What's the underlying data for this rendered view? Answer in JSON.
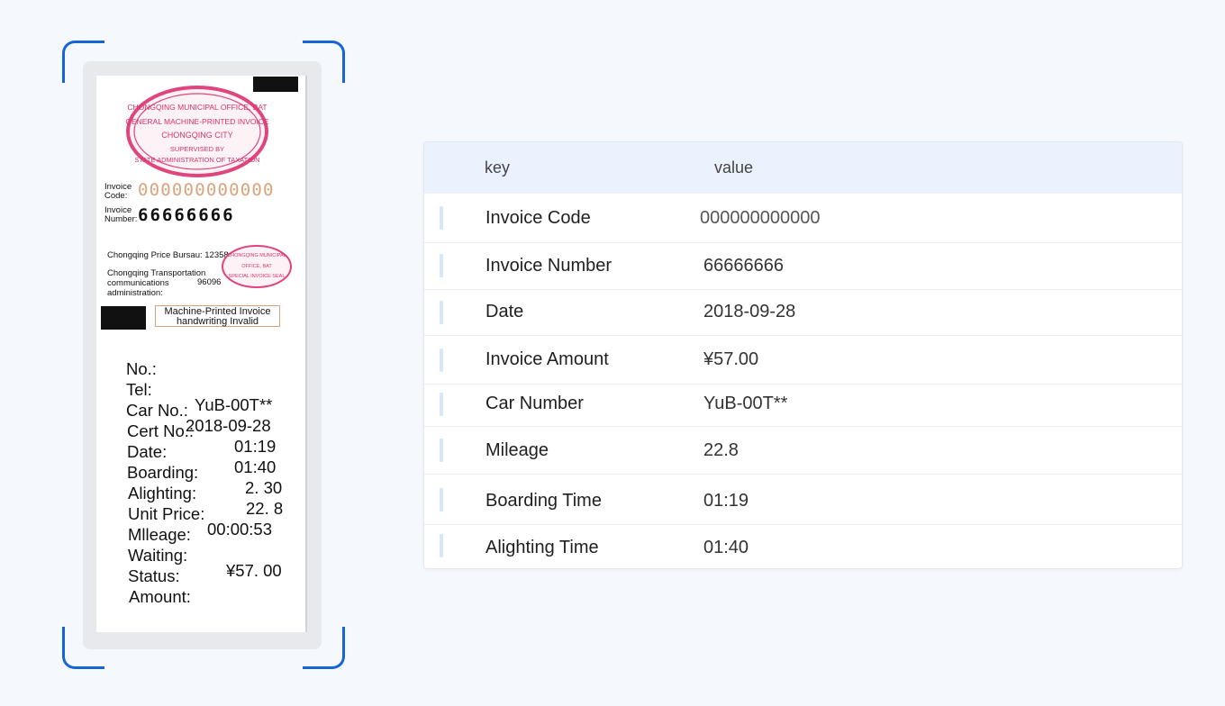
{
  "receipt": {
    "seal_main": {
      "line1": "CHONGQING MUNICIPAL OFFICE, BAT",
      "line2": "GENERAL MACHINE-PRINTED INVOICE",
      "line3": "CHONGQING CITY",
      "line4": "SUPERVISED BY",
      "line5": "STATE ADMINISTRATION OF TAXATION"
    },
    "invoice_code_label": "Invoice\nCode:",
    "invoice_code_digits": "000000000000",
    "invoice_number_label": "Invoice\nNumber:",
    "invoice_number_digits": "66666666",
    "price_bureau": "Chongqing Price Bursau: 12358",
    "transport_line1": "Chongqing Transportation",
    "transport_line2": "communications",
    "transport_line3": "administration:",
    "transport_number": "96096",
    "seal_small": {
      "line1": "CHONGQING MUNICIPAL",
      "line2": "OFFICE, BAT",
      "line3": "SPECIAL INVOICE SEAL"
    },
    "notice_line1": "Machine-Printed Invoice",
    "notice_line2": "handwriting Invalid",
    "labels": [
      "No.:",
      "Tel:",
      "Car No.:",
      "Cert No.:",
      "Date:",
      "Boarding:",
      "Alighting:",
      "Unit Price:",
      "Mlleage:",
      "Waiting:",
      "Status:",
      "Amount:"
    ],
    "values": {
      "car_no": "YuB-00T**",
      "date": "2018-09-28",
      "boarding": "01:19",
      "alighting": "01:40",
      "unit_price": "2. 30",
      "mileage": "22. 8",
      "waiting": "00:00:53",
      "amount": "¥57. 00"
    }
  },
  "table": {
    "header_key": "key",
    "header_value": "value",
    "rows": [
      {
        "key": "Invoice Code",
        "value": "000000000000"
      },
      {
        "key": "Invoice Number",
        "value": "66666666"
      },
      {
        "key": "Date",
        "value": "2018-09-28"
      },
      {
        "key": "Invoice Amount",
        "value": "¥57.00"
      },
      {
        "key": "Car Number",
        "value": "YuB-00T**"
      },
      {
        "key": "Mileage",
        "value": "22.8"
      },
      {
        "key": "Boarding Time",
        "value": "01:19"
      },
      {
        "key": "Alighting Time",
        "value": "01:40"
      }
    ]
  },
  "colors": {
    "accent": "#1565d8",
    "seal": "#e0457e",
    "header_bg": "#ebf2fd"
  }
}
